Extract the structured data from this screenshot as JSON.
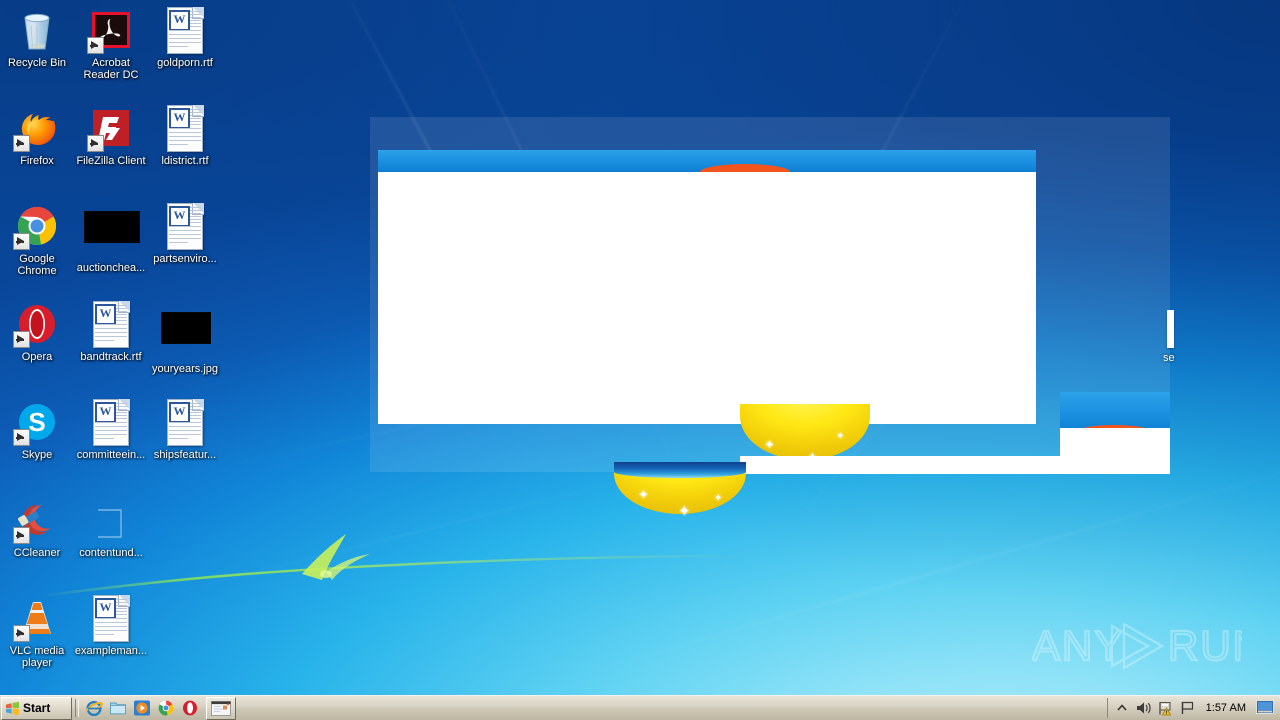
{
  "desktop": {
    "wallpaper_name": "windows-7-harmony-wallpaper",
    "colors": {
      "sky_deep": "#0a4ba3",
      "sky_mid": "#1186d8",
      "sky_light": "#8fe2f7",
      "grass_yellow": "#ffe815",
      "accent_orange": "#f2541c",
      "taskbar": "#d8d3c4"
    },
    "icons": [
      {
        "label": "Recycle Bin",
        "type": "recycle-bin",
        "shortcut": false,
        "col": 0,
        "row": 0
      },
      {
        "label": "Acrobat\nReader DC",
        "type": "acrobat",
        "shortcut": true,
        "col": 1,
        "row": 0
      },
      {
        "label": "goldporn.rtf",
        "type": "rtf-document",
        "shortcut": false,
        "col": 2,
        "row": 0
      },
      {
        "label": "Firefox",
        "type": "firefox",
        "shortcut": true,
        "col": 0,
        "row": 1
      },
      {
        "label": "FileZilla Client",
        "type": "filezilla",
        "shortcut": true,
        "col": 1,
        "row": 1
      },
      {
        "label": "ldistrict.rtf",
        "type": "rtf-document",
        "shortcut": false,
        "col": 2,
        "row": 1
      },
      {
        "label": "Google\nChrome",
        "type": "chrome",
        "shortcut": true,
        "col": 0,
        "row": 2
      },
      {
        "label": "auctionchea...",
        "type": "black-thumb",
        "shortcut": false,
        "col": 1,
        "row": 2
      },
      {
        "label": "partsenviro...",
        "type": "rtf-document",
        "shortcut": false,
        "col": 2,
        "row": 2
      },
      {
        "label": "Opera",
        "type": "opera",
        "shortcut": true,
        "col": 0,
        "row": 3
      },
      {
        "label": "bandtrack.rtf",
        "type": "rtf-document",
        "shortcut": false,
        "col": 1,
        "row": 3
      },
      {
        "label": "youryears.jpg",
        "type": "black-thumb",
        "shortcut": false,
        "col": 2,
        "row": 3
      },
      {
        "label": "Skype",
        "type": "skype",
        "shortcut": true,
        "col": 0,
        "row": 4
      },
      {
        "label": "committeein...",
        "type": "rtf-document",
        "shortcut": false,
        "col": 1,
        "row": 4
      },
      {
        "label": "shipsfeatur...",
        "type": "rtf-document",
        "shortcut": false,
        "col": 2,
        "row": 4
      },
      {
        "label": "CCleaner",
        "type": "ccleaner",
        "shortcut": true,
        "col": 0,
        "row": 5
      },
      {
        "label": "contentund...",
        "type": "blank-doc",
        "shortcut": false,
        "col": 1,
        "row": 5
      },
      {
        "label": "VLC media\nplayer",
        "type": "vlc",
        "shortcut": true,
        "col": 0,
        "row": 6
      },
      {
        "label": "exampleman...",
        "type": "rtf-document",
        "shortcut": false,
        "col": 1,
        "row": 6
      }
    ]
  },
  "window": {
    "name": "blank-render-window",
    "title": "",
    "has_content": false,
    "fragment_label": "se"
  },
  "watermark": {
    "text_left": "ANY",
    "text_right": "RUN",
    "icon": "play-triangle-icon"
  },
  "taskbar": {
    "start_label": "Start",
    "start_icon": "windows-logo-icon",
    "quick_launch": [
      {
        "name": "internet-explorer-icon",
        "title": "Internet Explorer"
      },
      {
        "name": "show-desktop-folder-icon",
        "title": "Windows Explorer"
      },
      {
        "name": "media-player-icon",
        "title": "Windows Media Player"
      },
      {
        "name": "chrome-icon",
        "title": "Google Chrome"
      },
      {
        "name": "opera-icon",
        "title": "Opera"
      }
    ],
    "task_buttons": [
      {
        "name": "document-window-button",
        "label": ""
      }
    ],
    "tray": {
      "icons": [
        {
          "name": "show-hidden-icons-icon",
          "glyph": "⌃"
        },
        {
          "name": "volume-speaker-icon",
          "glyph": "speaker"
        },
        {
          "name": "action-center-flag-icon",
          "glyph": "flag-warning"
        },
        {
          "name": "network-flag-icon",
          "glyph": "flag"
        }
      ],
      "clock": "1:57 AM",
      "show_desktop": "show-desktop-button"
    }
  }
}
